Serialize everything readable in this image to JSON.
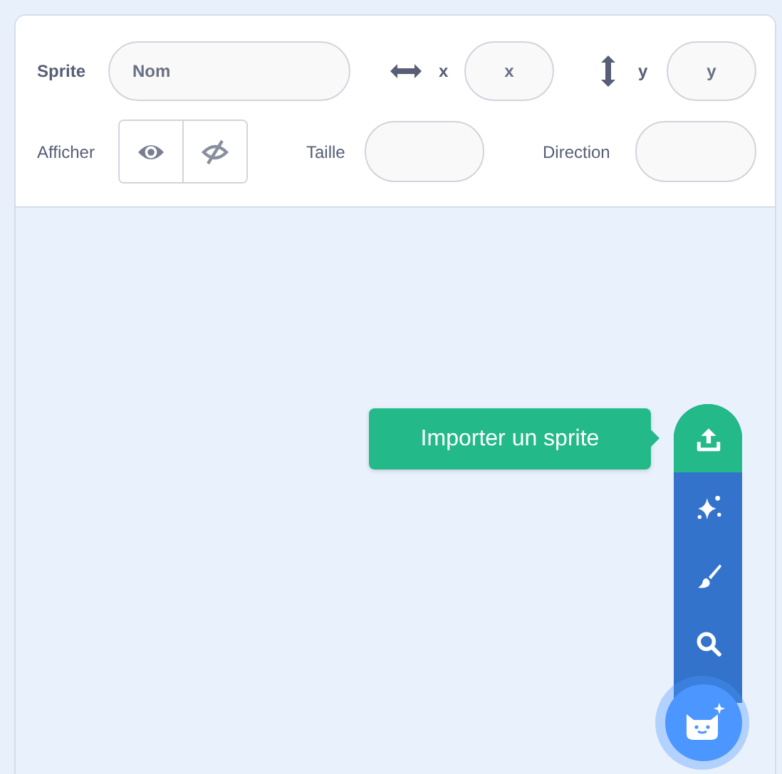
{
  "sprite_info": {
    "sprite_label": "Sprite",
    "name_field": {
      "placeholder": "Nom"
    },
    "x_label": "x",
    "x_field": {
      "placeholder": "x"
    },
    "y_label": "y",
    "y_field": {
      "placeholder": "y"
    },
    "show_label": "Afficher",
    "size_label": "Taille",
    "direction_label": "Direction"
  },
  "sprite_menu": {
    "tooltip": "Importer un sprite",
    "items": [
      {
        "kind": "upload",
        "selected": true
      },
      {
        "kind": "surprise",
        "selected": false
      },
      {
        "kind": "paint",
        "selected": false
      },
      {
        "kind": "search",
        "selected": false
      }
    ]
  }
}
